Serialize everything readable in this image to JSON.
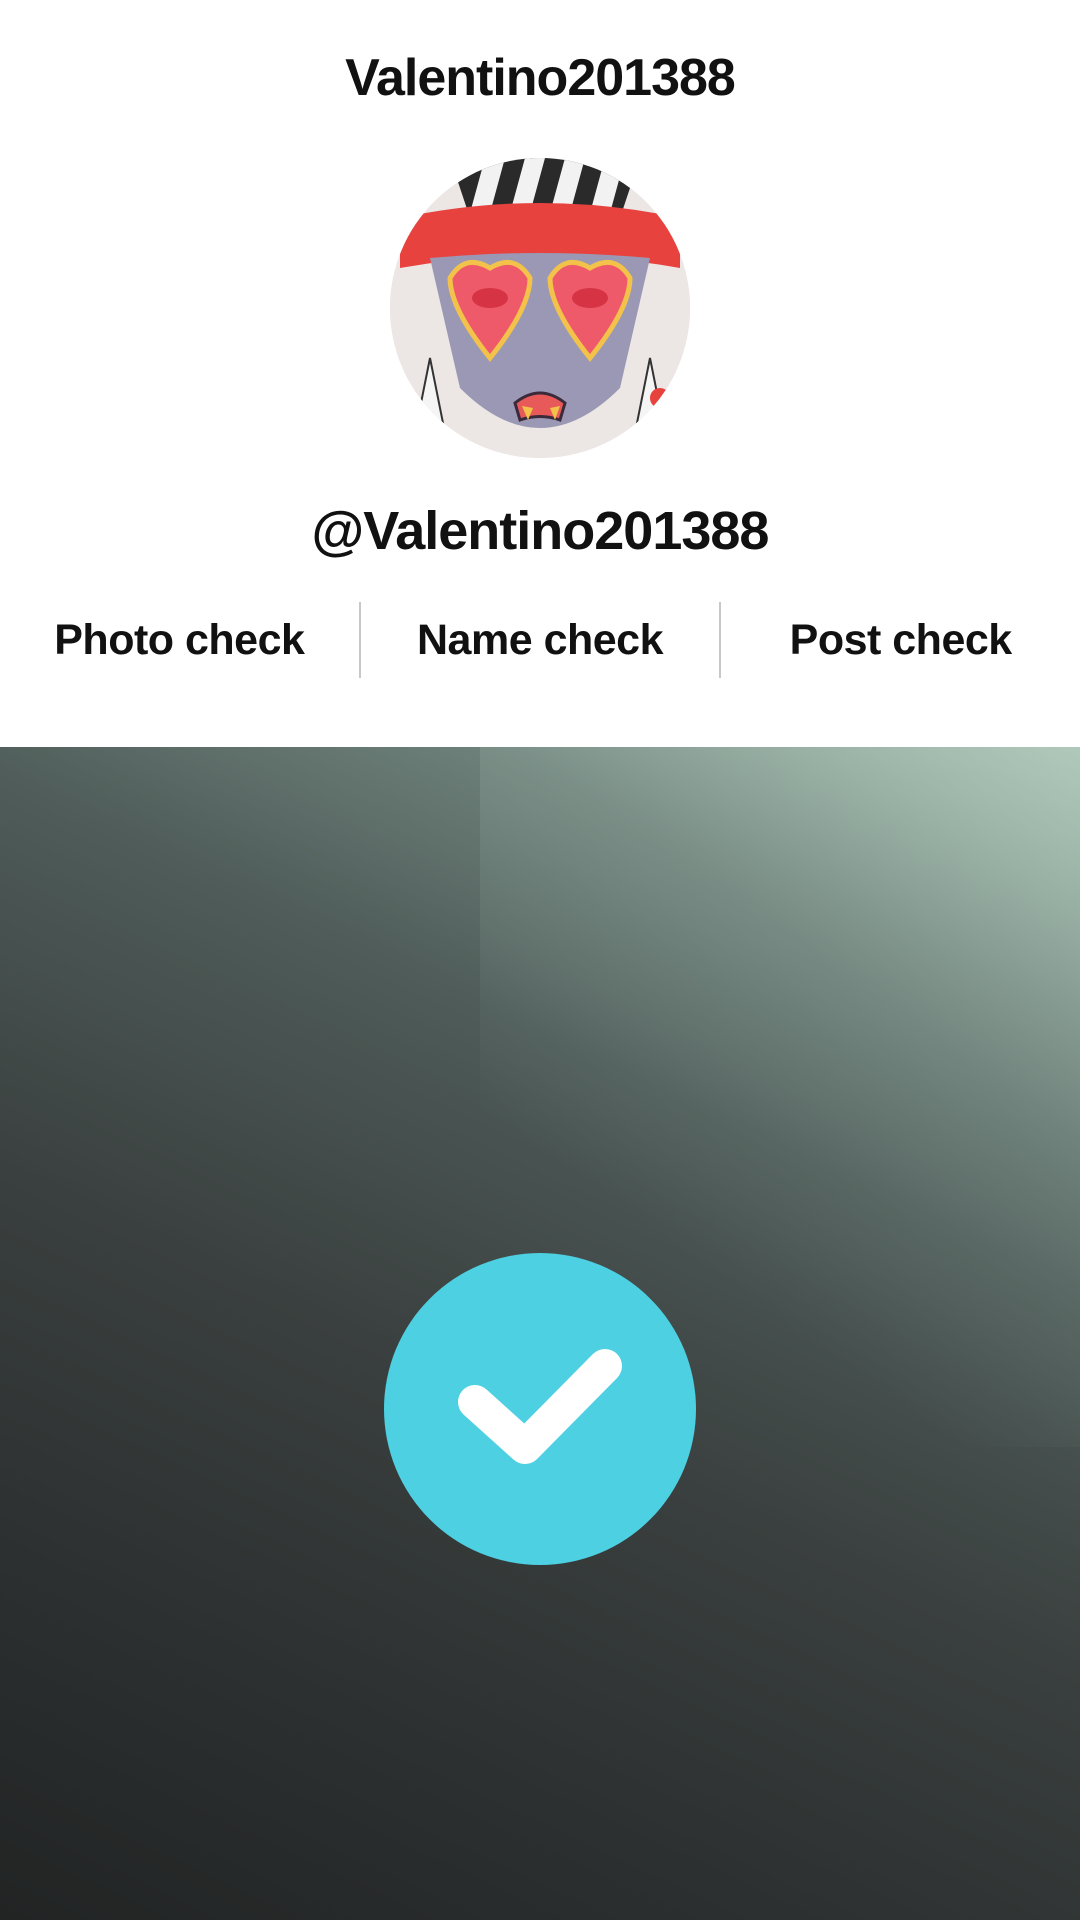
{
  "header": {
    "title": "Valentino201388",
    "handle": "@Valentino201388"
  },
  "avatar": {
    "icon": "avatar-image"
  },
  "checks": [
    {
      "label": "Photo check"
    },
    {
      "label": "Name check"
    },
    {
      "label": "Post check"
    }
  ],
  "badge": {
    "icon": "checkmark-icon",
    "color": "#4dd0e1"
  }
}
